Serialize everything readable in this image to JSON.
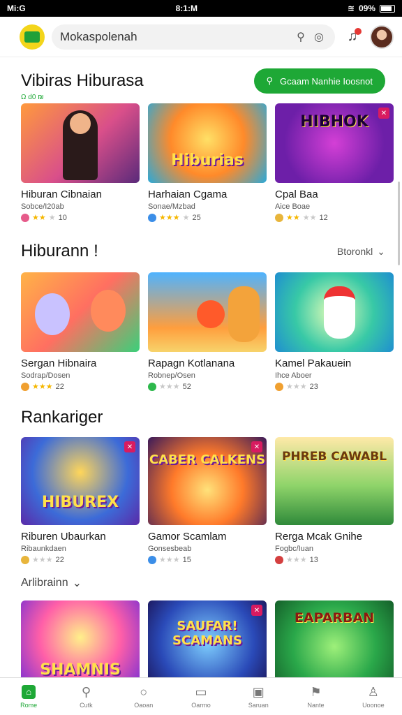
{
  "status": {
    "time": "Mi:G",
    "center": "8:1:M",
    "battery": "09%"
  },
  "header": {
    "brand": "Mokaspolenah",
    "search_placeholder": "",
    "search_value": ""
  },
  "section1": {
    "title": "Vibiras Hiburasa",
    "sublabel": "Ω d0 ₪",
    "button": "Gcaam Nanhie Ioosnot",
    "cards": [
      {
        "title": "Hiburan Cibnaian",
        "sub": "Sobce/I20ab",
        "rating": "10",
        "overlay": ""
      },
      {
        "title": "Harhaian Cgama",
        "sub": "Sonae/Mzbad",
        "rating": "25",
        "overlay": "Hiburias"
      },
      {
        "title": "Cpal Baa",
        "sub": "Aice Boae",
        "rating": "12",
        "overlay": "HIBHOK"
      }
    ]
  },
  "section2": {
    "title": "Hiburann !",
    "see_all": "Btoronkl",
    "cards": [
      {
        "title": "Sergan Hibnaira",
        "sub": "Sodrap/Dosen",
        "rating": "22",
        "overlay": ""
      },
      {
        "title": "Rapagn Kotlanana",
        "sub": "Robnep/Osen",
        "rating": "52",
        "overlay": ""
      },
      {
        "title": "Kamel Pakauein",
        "sub": "Ihce Aboer",
        "rating": "23",
        "overlay": ""
      }
    ]
  },
  "section3": {
    "title": "Rankariger",
    "cards": [
      {
        "title": "Riburen Ubaurkan",
        "sub": "Ribaunkdaen",
        "rating": "22",
        "overlay": "HIBUREX"
      },
      {
        "title": "Gamor Scamlam",
        "sub": "Gonsesbeab",
        "rating": "15",
        "overlay": "CABER CALKENS"
      },
      {
        "title": "Rerga Mcak Gnihe",
        "sub": "Fogbc/Iuan",
        "rating": "13",
        "overlay": "PHREB CAWABL"
      }
    ]
  },
  "section4": {
    "title": "Arlibrainn",
    "cards": [
      {
        "overlay": "SHAMNIS"
      },
      {
        "overlay": "SAUFAR! SCAMANS"
      },
      {
        "overlay": "EAPARBAN"
      }
    ]
  },
  "nav": [
    {
      "label": "Rome",
      "icon": "home-icon",
      "glyph": "⌂"
    },
    {
      "label": "Cutk",
      "icon": "search-icon",
      "glyph": "⚲"
    },
    {
      "label": "Oaoan",
      "icon": "circle-icon",
      "glyph": "○"
    },
    {
      "label": "Oarmo",
      "icon": "game-icon",
      "glyph": "▭"
    },
    {
      "label": "Saruan",
      "icon": "store-icon",
      "glyph": "▣"
    },
    {
      "label": "Nante",
      "icon": "bookmark-icon",
      "glyph": "⚑"
    },
    {
      "label": "Uoonoe",
      "icon": "profile-icon",
      "glyph": "♙"
    }
  ],
  "colors": {
    "accent": "#1ea836",
    "star": "#f5b700"
  }
}
